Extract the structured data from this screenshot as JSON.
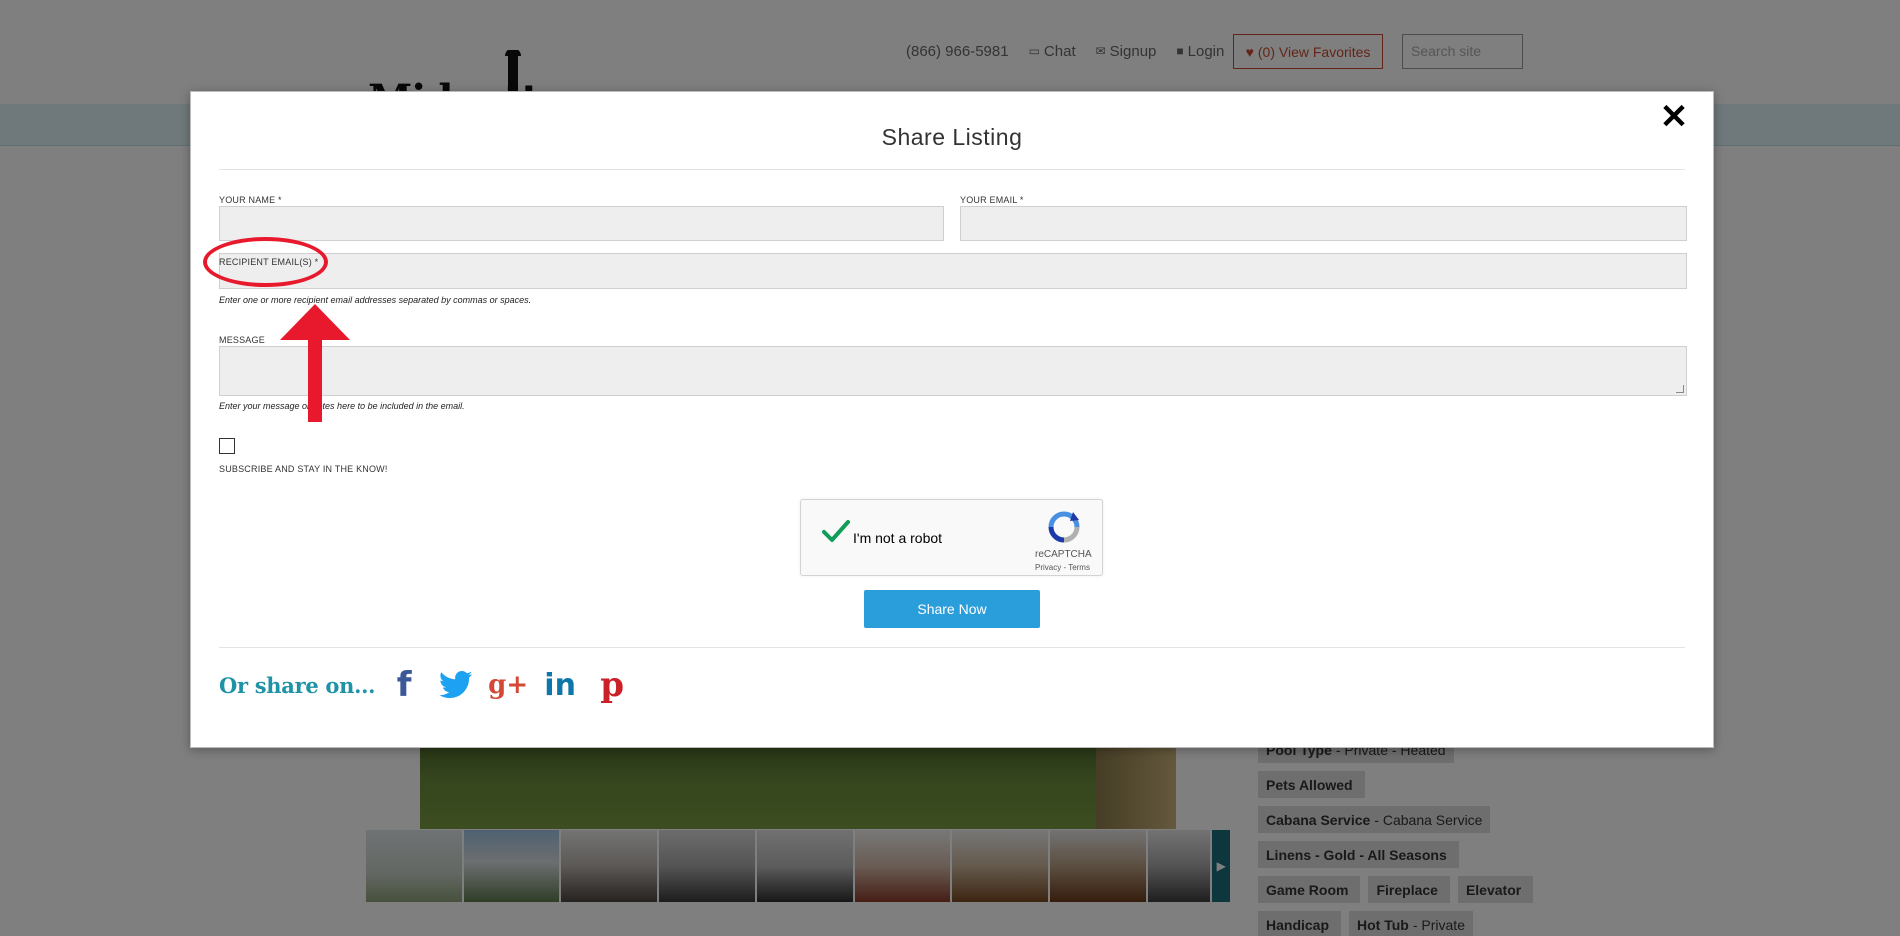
{
  "site": {
    "phone": "(866) 966-5981",
    "chat": "Chat",
    "signup": "Signup",
    "login": "Login",
    "favorites": "(0) View Favorites",
    "search_placeholder": "Search site",
    "logo_text": "Midgett Realty"
  },
  "amenities": [
    {
      "name": "Pool Type",
      "detail": "- Private - Heated"
    },
    {
      "name": "Pets Allowed",
      "detail": ""
    },
    {
      "name": "Cabana Service",
      "detail": "- Cabana Service"
    },
    {
      "name": "Linens - Gold - All Seasons",
      "detail": ""
    },
    {
      "name": "Game Room",
      "detail": ""
    },
    {
      "name": "Fireplace",
      "detail": ""
    },
    {
      "name": "Elevator",
      "detail": ""
    },
    {
      "name": "Handicap",
      "detail": ""
    },
    {
      "name": "Hot Tub",
      "detail": "- Private"
    }
  ],
  "modal": {
    "title": "Share Listing",
    "close": "✕",
    "name_label": "YOUR NAME *",
    "name_value": "",
    "email_label": "YOUR EMAIL *",
    "email_value": "",
    "recipient_label": "RECIPIENT EMAIL(S) *",
    "recipient_value": "",
    "recipient_hint": "Enter one or more recipient email addresses separated by commas or spaces.",
    "message_label": "MESSAGE",
    "message_value": "",
    "message_hint": "Enter your message or notes here to be included in the email.",
    "subscribe_label": "SUBSCRIBE AND STAY IN THE KNOW!",
    "subscribe_checked": false,
    "recaptcha": {
      "label": "I'm not a robot",
      "brand": "reCAPTCHA",
      "links": "Privacy - Terms",
      "checked": true
    },
    "submit_label": "Share Now",
    "share_on_label": "Or share on...",
    "social": [
      {
        "name": "facebook",
        "glyph": "f",
        "color": "#3b5998"
      },
      {
        "name": "twitter",
        "glyph": "",
        "color": "#1da1f2"
      },
      {
        "name": "google-plus",
        "glyph": "g+",
        "color": "#d34836"
      },
      {
        "name": "linkedin",
        "glyph": "in",
        "color": "#0e76a8"
      },
      {
        "name": "pinterest",
        "glyph": "p",
        "color": "#cb2027"
      }
    ]
  },
  "colors": {
    "accent": "#2a9ddb",
    "share_on_text": "#1f93a6",
    "annotation": "#e8192c",
    "favorites": "#c84b31"
  }
}
